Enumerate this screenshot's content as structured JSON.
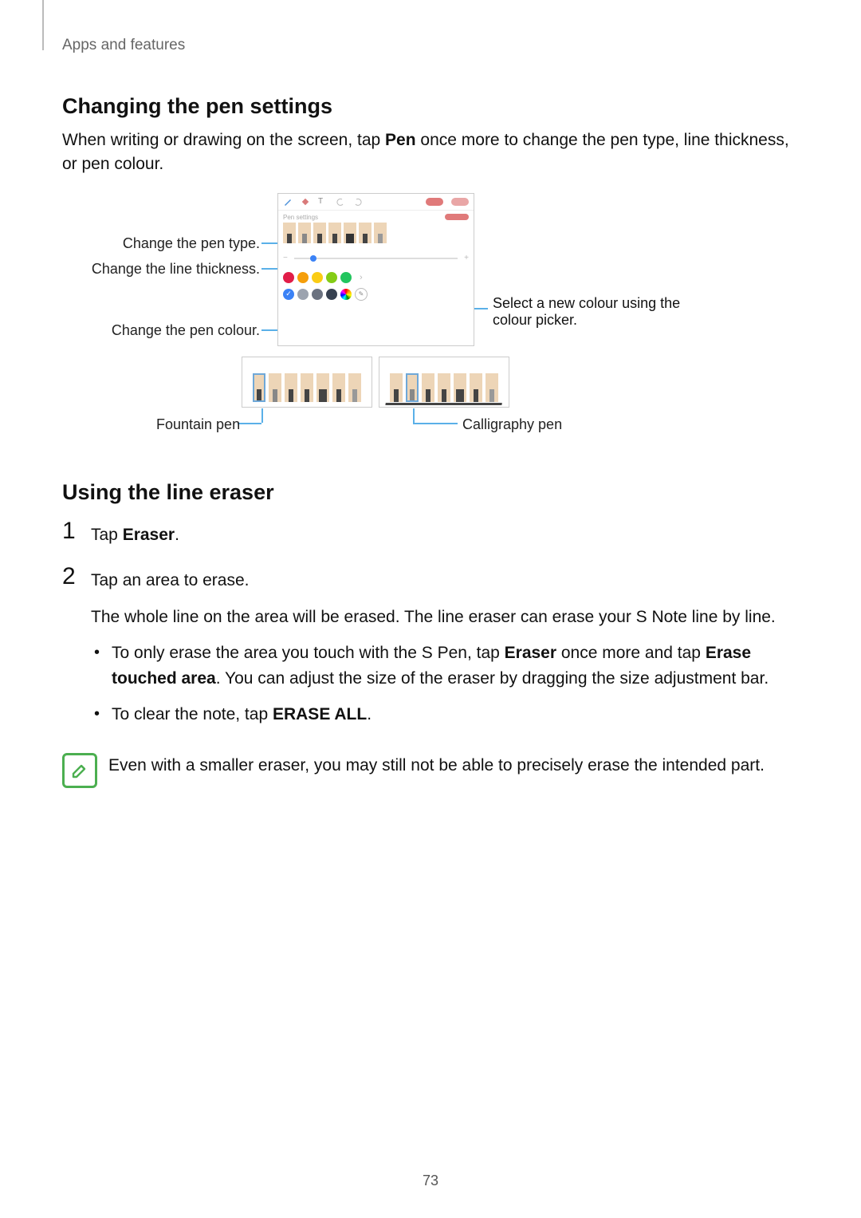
{
  "running_header": "Apps and features",
  "section1": {
    "heading": "Changing the pen settings",
    "intro_before": "When writing or drawing on the screen, tap ",
    "intro_bold": "Pen",
    "intro_after": " once more to change the pen type, line thickness, or pen colour."
  },
  "figure1": {
    "callout_pen_type": "Change the pen type.",
    "callout_thickness": "Change the line thickness.",
    "callout_pen_colour": "Change the pen colour.",
    "callout_colour_picker": "Select a new colour using the colour picker.",
    "callout_fountain": "Fountain pen",
    "callout_calligraphy": "Calligraphy pen",
    "pen_settings_label": "Pen settings",
    "thick_minus": "−",
    "thick_plus": "+",
    "check_glyph": "✓",
    "picker_glyph": "✎",
    "chevron": "›",
    "colour_row1": [
      "#e11d48",
      "#f59e0b",
      "#facc15",
      "#84cc16",
      "#22c55e"
    ],
    "colour_row2_grey": [
      "#9ca3af",
      "#6b7280",
      "#374151"
    ],
    "colour_row2_multi": "conic-gradient(red,orange,yellow,green,cyan,blue,magenta,red)"
  },
  "section2": {
    "heading": "Using the line eraser",
    "step1_before": "Tap ",
    "step1_bold": "Eraser",
    "step1_after": ".",
    "step2_line1": "Tap an area to erase.",
    "step2_line2": "The whole line on the area will be erased. The line eraser can erase your S Note line by line.",
    "bullet1_a": "To only erase the area you touch with the S Pen, tap ",
    "bullet1_bold1": "Eraser",
    "bullet1_b": " once more and tap ",
    "bullet1_bold2": "Erase touched area",
    "bullet1_c": ". You can adjust the size of the eraser by dragging the size adjustment bar.",
    "bullet2_a": "To clear the note, tap ",
    "bullet2_bold": "ERASE ALL",
    "bullet2_b": "."
  },
  "note": "Even with a smaller eraser, you may still not be able to precisely erase the intended part.",
  "page_number": "73"
}
